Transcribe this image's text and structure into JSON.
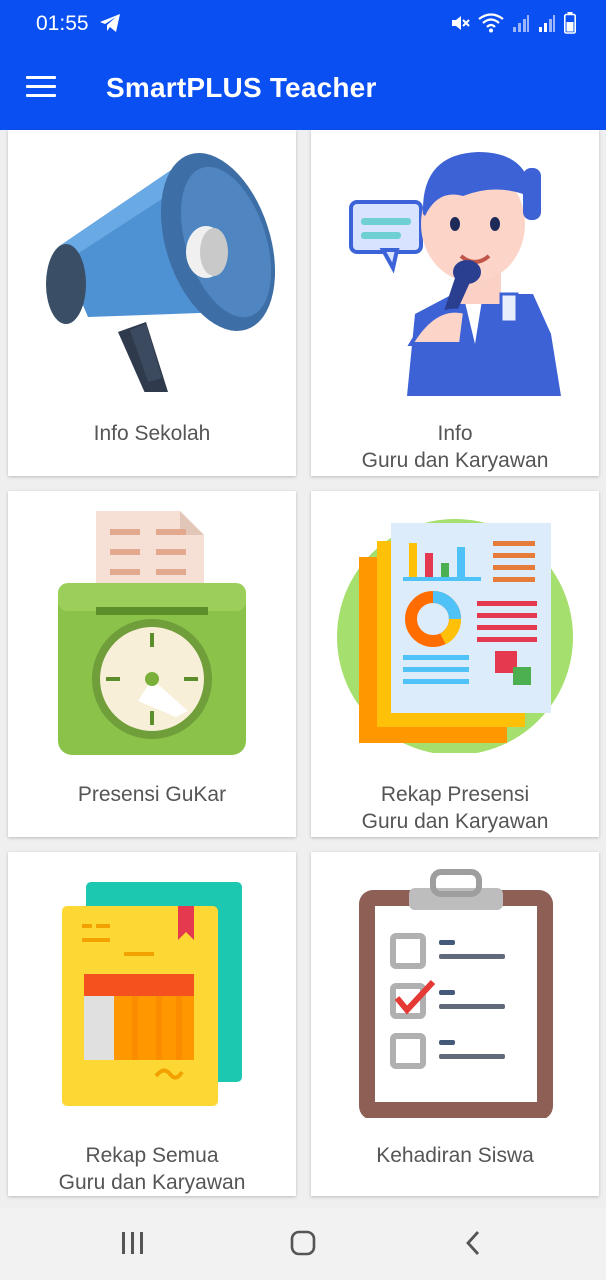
{
  "status_bar": {
    "time": "01:55",
    "icons": [
      "telegram-icon",
      "mute-icon",
      "wifi-icon",
      "signal-icon",
      "signal-icon",
      "battery-icon"
    ]
  },
  "app_bar": {
    "title": "SmartPLUS Teacher",
    "menu_icon": "hamburger-menu-icon"
  },
  "menu": {
    "items": [
      {
        "line1": "Info Sekolah",
        "line2": "",
        "icon": "megaphone-icon"
      },
      {
        "line1": "Info",
        "line2": "Guru dan Karyawan",
        "icon": "presenter-icon"
      },
      {
        "line1": "Presensi GuKar",
        "line2": "",
        "icon": "time-clock-icon"
      },
      {
        "line1": "Rekap Presensi",
        "line2": "Guru dan Karyawan",
        "icon": "report-chart-icon"
      },
      {
        "line1": "Rekap Semua",
        "line2": "Guru dan Karyawan",
        "icon": "document-folder-icon"
      },
      {
        "line1": "Kehadiran Siswa",
        "line2": "",
        "icon": "clipboard-checklist-icon"
      }
    ]
  },
  "nav_bar": {
    "icons": [
      "recent-apps-icon",
      "home-icon",
      "back-icon"
    ]
  },
  "colors": {
    "primary": "#0a4ff2",
    "card": "#ffffff",
    "background": "#efefef",
    "label": "#555555"
  }
}
